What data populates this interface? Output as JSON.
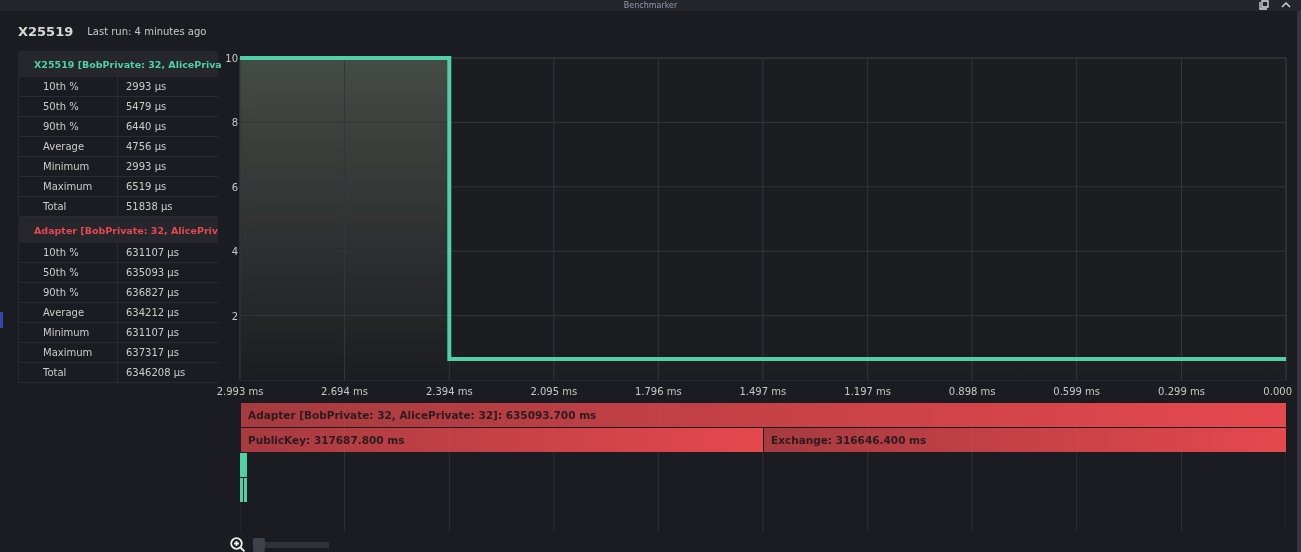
{
  "window": {
    "title": "Benchmarker"
  },
  "header": {
    "title": "X25519",
    "subtitle": "Last run: 4 minutes ago"
  },
  "groups": [
    {
      "title": "X25519 [BobPrivate: 32, AlicePriva",
      "color": "#4fd1a5",
      "expanded": true,
      "rows": [
        [
          "10th %",
          "2993 µs"
        ],
        [
          "50th %",
          "5479 µs"
        ],
        [
          "90th %",
          "6440 µs"
        ],
        [
          "Average",
          "4756 µs"
        ],
        [
          "Minimum",
          "2993 µs"
        ],
        [
          "Maximum",
          "6519 µs"
        ],
        [
          "Total",
          "51838 µs"
        ]
      ]
    },
    {
      "title": "Adapter [BobPrivate: 32, AlicePriv",
      "color": "#e5484d",
      "expanded": true,
      "rows": [
        [
          "10th %",
          "631107 µs"
        ],
        [
          "50th %",
          "635093 µs"
        ],
        [
          "90th %",
          "636827 µs"
        ],
        [
          "Average",
          "634212 µs"
        ],
        [
          "Minimum",
          "631107 µs"
        ],
        [
          "Maximum",
          "637317 µs"
        ],
        [
          "Total",
          "6346208 µs"
        ]
      ]
    }
  ],
  "chart_data": {
    "type": "area",
    "x": [
      2.993,
      2.394,
      2.394,
      0
    ],
    "grid": true,
    "series": [
      {
        "color": "#4fd1a5",
        "values": [
          10,
          10,
          0.65,
          0.65
        ]
      }
    ],
    "xlim": [
      2.993,
      0
    ],
    "ylim": [
      0,
      10
    ],
    "xticks": [
      {
        "value": 2.993,
        "label": "2.993 ms"
      },
      {
        "value": 2.694,
        "label": "2.694 ms"
      },
      {
        "value": 2.394,
        "label": "2.394 ms"
      },
      {
        "value": 2.095,
        "label": "2.095 ms"
      },
      {
        "value": 1.796,
        "label": "1.796 ms"
      },
      {
        "value": 1.497,
        "label": "1.497 ms"
      },
      {
        "value": 1.197,
        "label": "1.197 ms"
      },
      {
        "value": 0.898,
        "label": "0.898 ms"
      },
      {
        "value": 0.599,
        "label": "0.599 ms"
      },
      {
        "value": 0.299,
        "label": "0.299 ms"
      },
      {
        "value": 0,
        "label": "0.000"
      }
    ],
    "yticks": [
      2,
      4,
      6,
      8,
      10
    ]
  },
  "flame": [
    {
      "bars": [
        {
          "label": "Adapter [BobPrivate: 32, AlicePrivate: 32]: 635093.700 ms",
          "color": "#e5484d"
        }
      ]
    },
    {
      "bars": [
        {
          "label": "PublicKey: 317687.800 ms",
          "color": "#e5484d"
        },
        {
          "label": "Exchange: 316646.400 ms",
          "color": "#e5484d"
        }
      ]
    },
    {
      "bars": [
        {
          "color": "#4fd1a5"
        }
      ]
    },
    {
      "bars": [
        {
          "color": "#4fd1a5"
        },
        {
          "color": "#4fd1a5"
        }
      ]
    }
  ],
  "zoom": {
    "level": 0
  }
}
